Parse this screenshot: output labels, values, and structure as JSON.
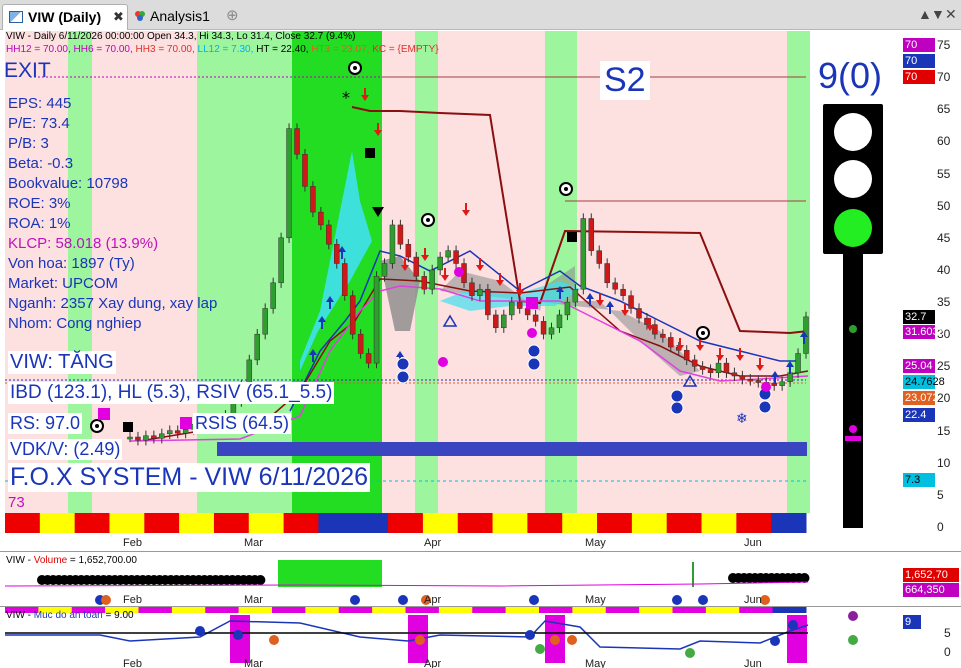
{
  "tabs": [
    {
      "label": "VIW (Daily)",
      "active": true
    },
    {
      "label": "Analysis1",
      "active": false
    }
  ],
  "window_buttons": [
    "▲",
    "▼",
    "✕"
  ],
  "chart_header": {
    "line1": "VIW - Daily 6/11/2026 00:00:00 Open 34.3, Hi 34.3, Lo 31.4, Close 32.7 (9.4%)",
    "line2_parts": [
      {
        "text": "HH12 = 70.00, ",
        "color": "#c000c0"
      },
      {
        "text": "HH6 = 70.00, ",
        "color": "#c000c0"
      },
      {
        "text": "HH3 = 70.00, ",
        "color": "#e0302a"
      },
      {
        "text": "LL12 = 7.30, ",
        "color": "#00b0f0"
      },
      {
        "text": "HT = 22.40, ",
        "color": "#000000"
      },
      {
        "text": "HT3 = 23.07, ",
        "color": "#e06020"
      },
      {
        "text": "KC = {EMPTY}",
        "color": "#e0302a"
      }
    ]
  },
  "signals": {
    "exit": "EXIT",
    "stage": "S2",
    "score": "9(0)"
  },
  "fundamentals": [
    {
      "label": "EPS: 445",
      "color": "blue"
    },
    {
      "label": "P/E: 73.4",
      "color": "blue"
    },
    {
      "label": "P/B: 3",
      "color": "blue"
    },
    {
      "label": "Beta: -0.3",
      "color": "blue"
    },
    {
      "label": "Bookvalue: 10798",
      "color": "blue"
    },
    {
      "label": "ROE: 3%",
      "color": "blue"
    },
    {
      "label": "ROA: 1%",
      "color": "blue"
    },
    {
      "label": "KLCP: 58.018 (13.9%)",
      "color": "magenta"
    },
    {
      "label": "Von hoa: 1897 (Ty)",
      "color": "blue"
    },
    {
      "label": "Market: UPCOM",
      "color": "blue"
    },
    {
      "label": "Nganh: 2357 Xay dung, xay lap",
      "color": "blue"
    },
    {
      "label": "Nhom: Cong nghiep",
      "color": "blue"
    }
  ],
  "status": {
    "trend": "VIW: TĂNG",
    "ibd": "IBD (123.1), HL (5.3), RSIV (65.1_5.5)",
    "rs": "RS: 97.0",
    "rsis": "RSIS (64.5)",
    "vdk": "VDK/V:  (2.49)",
    "system": "F.O.X SYSTEM - VIW 6/11/2026",
    "small_number": "73"
  },
  "price_axis": {
    "ticks": [
      "75",
      "70",
      "65",
      "60",
      "55",
      "50",
      "45",
      "40",
      "35",
      "30",
      "25",
      "20",
      "15",
      "10",
      "5",
      "0"
    ],
    "ylim": [
      0,
      75
    ],
    "tags": [
      {
        "text": "70",
        "value": 75,
        "bg": "#c000c0",
        "fg": "#ffffff"
      },
      {
        "text": "70",
        "value": 72.5,
        "bg": "#1a35b8",
        "fg": "#ffffff"
      },
      {
        "text": "70",
        "value": 70,
        "bg": "#e00000",
        "fg": "#ffffff"
      },
      {
        "text": "32.7",
        "value": 32.7,
        "bg": "#000000",
        "fg": "#ffffff"
      },
      {
        "text": "31.6038",
        "value": 30.4,
        "bg": "#c000c0",
        "fg": "#ffffff"
      },
      {
        "text": "25.04",
        "value": 25.04,
        "bg": "#c000c0",
        "fg": "#ffffff"
      },
      {
        "text": "24.7628",
        "value": 22.6,
        "bg": "#00bfe0",
        "fg": "#000000"
      },
      {
        "text": "23.072",
        "value": 20.0,
        "bg": "#e06020",
        "fg": "#ffffff"
      },
      {
        "text": "22.4",
        "value": 17.5,
        "bg": "#1a35b8",
        "fg": "#ffffff"
      },
      {
        "text": "7.3",
        "value": 7.3,
        "bg": "#00bfe0",
        "fg": "#000000"
      }
    ]
  },
  "months": [
    "Feb",
    "Mar",
    "Apr",
    "May",
    "Jun"
  ],
  "volume_pane": {
    "header_name": "VIW - ",
    "header_label": "Volume",
    "header_value": " = 1,652,700.00",
    "tags": [
      {
        "text": "1,652,70",
        "bg": "#e00000",
        "fg": "#ffffff"
      },
      {
        "text": "664,350",
        "bg": "#c000c0",
        "fg": "#ffffff"
      }
    ]
  },
  "safety_pane": {
    "header_name": "VIW - ",
    "header_label": "Muc do an toan",
    "header_value": " = 9.00",
    "ticks": [
      "5",
      "0"
    ],
    "tag": {
      "text": "9",
      "bg": "#1a35b8",
      "fg": "#ffffff"
    }
  },
  "chart_data": {
    "type": "candlestick",
    "ylim": [
      0,
      75
    ],
    "closes": [
      14,
      13.5,
      14.2,
      13.8,
      14.5,
      15,
      14.6,
      15.2,
      16,
      15.4,
      15.8,
      16.5,
      17.4,
      19.5,
      22,
      26,
      30,
      34,
      38,
      45,
      62,
      58,
      53,
      49,
      47,
      44,
      41,
      36,
      30,
      27,
      25.5,
      39,
      41,
      47,
      44,
      42,
      39,
      37,
      40,
      42,
      43,
      41,
      38,
      36,
      37,
      33,
      31,
      33,
      35,
      34,
      33,
      32,
      30,
      31,
      33,
      35,
      37,
      48,
      43,
      41,
      38,
      37,
      36,
      34,
      32.5,
      31.5,
      30,
      29.5,
      28,
      27.5,
      26,
      25,
      24.5,
      24,
      25.5,
      24,
      23.5,
      23,
      22.8,
      22.5,
      22.4,
      22,
      22.6,
      24,
      27,
      32.7
    ]
  }
}
